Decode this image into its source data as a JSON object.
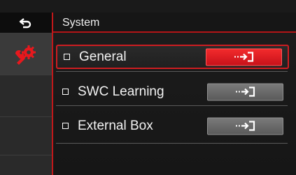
{
  "header": {
    "title": "System"
  },
  "sidebar": {
    "back_icon": "back-arrow-icon",
    "active_icon": "settings-wrench-icon"
  },
  "menu": {
    "items": [
      {
        "label": "General",
        "selected": true
      },
      {
        "label": "SWC Learning",
        "selected": false
      },
      {
        "label": "External Box",
        "selected": false
      }
    ]
  },
  "colors": {
    "accent": "#cf1d21",
    "button_active": "#e8181d",
    "button_inactive": "#6b6b6b"
  }
}
